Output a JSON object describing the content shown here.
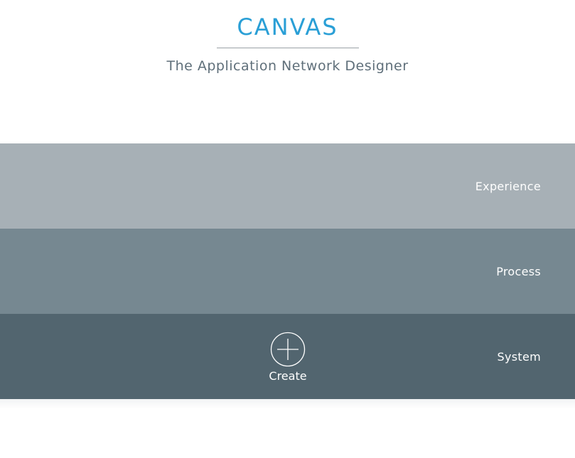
{
  "header": {
    "title": "CANVAS",
    "subtitle": "The Application Network Designer"
  },
  "layers": [
    {
      "label": "Experience"
    },
    {
      "label": "Process"
    },
    {
      "label": "System"
    }
  ],
  "create_button": {
    "label": "Create",
    "icon": "plus-circle-icon"
  },
  "colors": {
    "title": "#2a9fd6",
    "experience_layer": "#a7b0b6",
    "process_layer": "#768891",
    "system_layer": "#52656f"
  }
}
